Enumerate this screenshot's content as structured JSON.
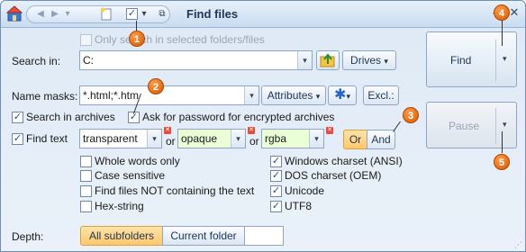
{
  "title": "Find files",
  "search": {
    "only_selected_label": "Only search in selected folders/files",
    "search_in_label": "Search in:",
    "search_in_value": "C:",
    "drives_label": "Drives"
  },
  "masks": {
    "label": "Name masks:",
    "value": "*.html;*.htm",
    "attributes_label": "Attributes",
    "excl_label": "Excl.:"
  },
  "options": {
    "search_archives": "Search in archives",
    "ask_password": "Ask for password for encrypted archives",
    "find_text": "Find text"
  },
  "text_terms": {
    "term1": "transparent",
    "or1": "or",
    "term2": "opaque",
    "or2": "or",
    "term3": "rgba",
    "or_button": "Or",
    "and_button": "And"
  },
  "left_checks": [
    {
      "label": "Whole words only"
    },
    {
      "label": "Case sensitive"
    },
    {
      "label": "Find files NOT containing the text"
    },
    {
      "label": "Hex-string"
    }
  ],
  "right_checks": [
    {
      "label": "Windows charset (ANSI)"
    },
    {
      "label": "DOS charset (OEM)"
    },
    {
      "label": "Unicode"
    },
    {
      "label": "UTF8"
    }
  ],
  "depth": {
    "label": "Depth:",
    "all_subfolders": "All subfolders",
    "current_folder": "Current folder"
  },
  "buttons": {
    "find": "Find",
    "pause": "Pause"
  },
  "callouts": [
    "1",
    "2",
    "3",
    "4",
    "5"
  ],
  "colors": {
    "accent_orange": "#ffc86a",
    "green_field": "#eaffd6",
    "badge": "#e06a10"
  }
}
